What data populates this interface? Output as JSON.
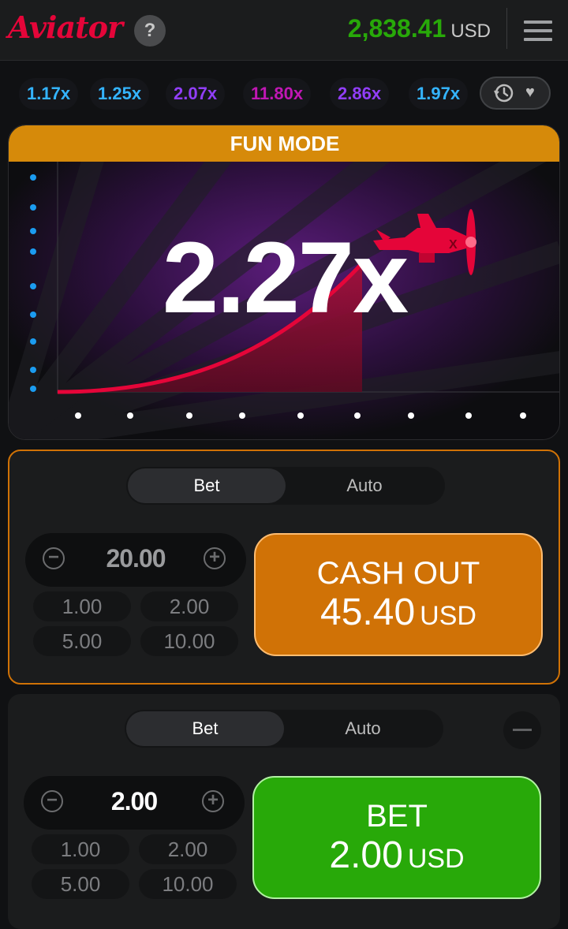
{
  "header": {
    "logo": "Aviator",
    "help_symbol": "?",
    "balance": "2,838.41",
    "currency": "USD",
    "menu_icon": "hamburger-menu-icon"
  },
  "history": {
    "items": [
      {
        "value": "1.17x",
        "color": "#34b4ff"
      },
      {
        "value": "1.25x",
        "color": "#34b4ff"
      },
      {
        "value": "2.07x",
        "color": "#913ef8"
      },
      {
        "value": "11.80x",
        "color": "#c017b4"
      },
      {
        "value": "2.86x",
        "color": "#913ef8"
      },
      {
        "value": "1.97x",
        "color": "#34b4ff"
      }
    ],
    "icons": [
      "history-clock-icon",
      "heart-icon"
    ]
  },
  "game": {
    "banner": "FUN MODE",
    "multiplier": "2.27x",
    "accent_color": "#e50539"
  },
  "panels": [
    {
      "tabs": [
        "Bet",
        "Auto"
      ],
      "selected_tab": "Bet",
      "stake": "20.00",
      "quick_amounts": [
        "1.00",
        "2.00",
        "5.00",
        "10.00"
      ],
      "action_label": "CASH OUT",
      "action_amount": "45.40",
      "action_currency": "USD",
      "action_color": "#d07206"
    },
    {
      "tabs": [
        "Bet",
        "Auto"
      ],
      "selected_tab": "Bet",
      "stake": "2.00",
      "quick_amounts": [
        "1.00",
        "2.00",
        "5.00",
        "10.00"
      ],
      "action_label": "BET",
      "action_amount": "2.00",
      "action_currency": "USD",
      "action_color": "#28a909"
    }
  ]
}
